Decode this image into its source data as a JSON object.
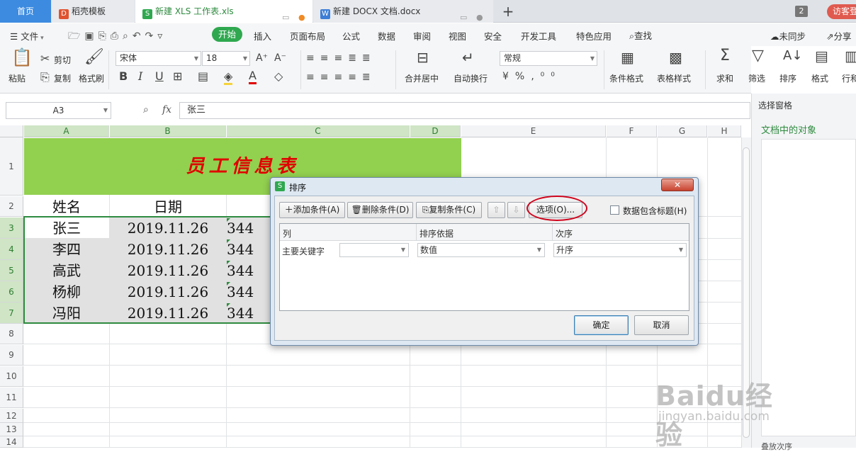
{
  "tabs": {
    "home": "首页",
    "template": "稻壳模板",
    "xls": "新建 XLS 工作表.xls",
    "docx": "新建 DOCX 文档.docx",
    "window_count": "2",
    "visitor": "访客登"
  },
  "menu": {
    "file": "文件",
    "start": "开始",
    "insert": "插入",
    "layout": "页面布局",
    "formula": "公式",
    "data": "数据",
    "review": "审阅",
    "view": "视图",
    "security": "安全",
    "dev": "开发工具",
    "special": "特色应用",
    "search": "查找",
    "sync": "未同步",
    "share": "分享"
  },
  "toolbar": {
    "paste": "粘贴",
    "cut": "剪切",
    "copy": "复制",
    "format_painter": "格式刷",
    "font": "宋体",
    "size": "18",
    "number_format": "常规",
    "merge": "合并居中",
    "wrap": "自动换行",
    "cond_format": "条件格式",
    "table_style": "表格样式",
    "sum": "求和",
    "filter": "筛选",
    "sort": "排序",
    "format": "格式",
    "rowcol": "行和"
  },
  "formula_bar": {
    "cell_ref": "A3",
    "fx": "fx",
    "content": "张三"
  },
  "right_pane": {
    "title": "选择窗格",
    "subtitle": "文档中的对象",
    "bottom": "叠放次序"
  },
  "columns": [
    "A",
    "B",
    "C",
    "D",
    "E",
    "F",
    "G",
    "H"
  ],
  "rows": [
    "1",
    "2",
    "3",
    "4",
    "5",
    "6",
    "7",
    "8",
    "9",
    "10",
    "11",
    "12",
    "13",
    "14"
  ],
  "sheet": {
    "title": "员工信息表",
    "headers": [
      "姓名",
      "日期"
    ],
    "data": [
      [
        "张三",
        "2019.11.26",
        "344"
      ],
      [
        "李四",
        "2019.11.26",
        "344"
      ],
      [
        "高武",
        "2019.11.26",
        "344"
      ],
      [
        "杨柳",
        "2019.11.26",
        "344"
      ],
      [
        "冯阳",
        "2019.11.26",
        "344"
      ]
    ]
  },
  "dialog": {
    "title": "排序",
    "add": "添加条件(A)",
    "delete": "删除条件(D)",
    "copy": "复制条件(C)",
    "options": "选项(O)...",
    "has_header": "数据包含标题(H)",
    "col_header": "列",
    "basis_header": "排序依据",
    "order_header": "次序",
    "primary_key": "主要关键字",
    "basis_value": "数值",
    "order_value": "升序",
    "ok": "确定",
    "cancel": "取消"
  },
  "watermark": {
    "brand": "Baidu经验",
    "url": "jingyan.baidu.com"
  },
  "colors": {
    "accent": "#2fa84f",
    "header_fill": "#92d050",
    "title_text": "#e00000",
    "highlight_circle": "#d0021b"
  }
}
